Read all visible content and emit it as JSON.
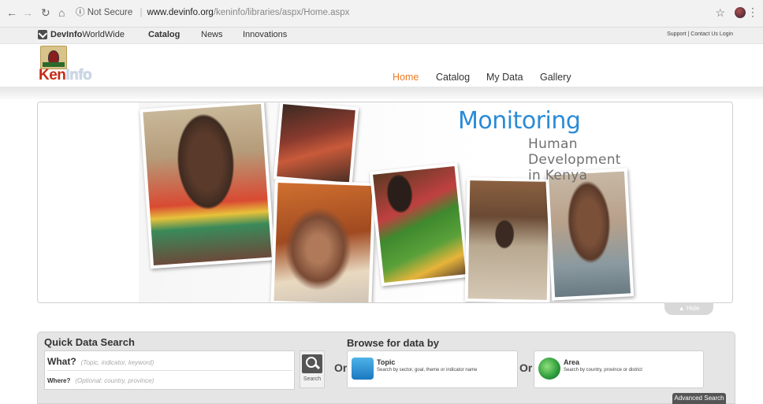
{
  "browser": {
    "security": "Not Secure",
    "url_host": "www.devinfo.org",
    "url_path": "/keninfo/libraries/aspx/Home.aspx"
  },
  "devinfo_bar": {
    "logo_bold": "DevInfo",
    "logo_rest": "WorldWide",
    "menu": [
      "Catalog",
      "News",
      "Innovations"
    ],
    "utility_links": "Support | Contact Us Login"
  },
  "site": {
    "brand_ken": "Ken",
    "brand_info": "Info",
    "nav": [
      {
        "label": "Home",
        "active": true
      },
      {
        "label": "Catalog",
        "active": false
      },
      {
        "label": "My Data",
        "active": false
      },
      {
        "label": "Gallery",
        "active": false
      }
    ],
    "accent_color": "#ee7b21"
  },
  "banner": {
    "title": "Monitoring",
    "subtitle": "Human Development in Kenya",
    "hide_label": "Hide"
  },
  "quick_search": {
    "heading": "Quick Data Search",
    "what_label": "What?",
    "what_placeholder": "(Topic, indicator, keyword)",
    "where_label": "Where?",
    "where_placeholder": "(Optional: country, province)",
    "search_button": "Search"
  },
  "browse": {
    "heading": "Browse for data by",
    "or_1": "Or",
    "or_2": "Or",
    "topic_title": "Topic",
    "topic_desc": "Search by sector, goal, theme or indicator name",
    "area_title": "Area",
    "area_desc": "Search by country, province or district",
    "advanced_search": "Advanced Search"
  }
}
